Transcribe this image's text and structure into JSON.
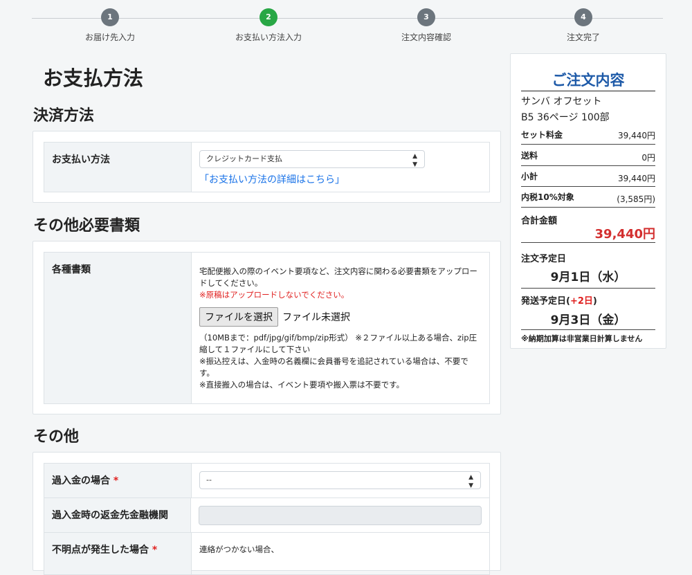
{
  "steps": [
    {
      "num": "1",
      "label": "お届け先入力"
    },
    {
      "num": "2",
      "label": "お支払い方法入力"
    },
    {
      "num": "3",
      "label": "注文内容確認"
    },
    {
      "num": "4",
      "label": "注文完了"
    }
  ],
  "page_title": "お支払方法",
  "payment": {
    "section_title": "決済方法",
    "row_label": "お支払い方法",
    "select_value": "クレジットカード支払",
    "detail_link": "「お支払い方法の詳細はこちら」"
  },
  "documents": {
    "section_title": "その他必要書類",
    "row_label": "各種書類",
    "desc": "宅配便搬入の際のイベント要項など、注文内容に関わる必要書類をアップロードしてください。",
    "warning": "※原稿はアップロードしないでください。",
    "file_button": "ファイルを選択",
    "file_status": "ファイル未選択",
    "note1": "（10MBまで：pdf/jpg/gif/bmp/zip形式） ※２ファイル以上ある場合、zip圧縮して１ファイルにして下さい",
    "note2": "※振込控えは、入金時の名義欄に会員番号を追記されている場合は、不要です。",
    "note3": "※直接搬入の場合は、イベント要項や搬入票は不要です。"
  },
  "other": {
    "section_title": "その他",
    "row1_label": "過入金の場合",
    "row1_select": "--",
    "row2_label": "過入金時の返金先金融機関",
    "row3_label": "不明点が発生した場合",
    "row3_text": "連絡がつかない場合、",
    "required_mark": "*"
  },
  "summary": {
    "title": "ご注文内容",
    "product_name": "サンバ オフセット",
    "product_spec": "B5  36ページ  100部",
    "set_price_label": "セット料金",
    "set_price": "39,440円",
    "shipping_label": "送料",
    "shipping": "0円",
    "subtotal_label": "小計",
    "subtotal": "39,440円",
    "tax_label": "内税10%対象",
    "tax": "(3,585円)",
    "total_label": "合計金額",
    "total": "39,440円",
    "order_date_label": "注文予定日",
    "order_date": "9月1日（水）",
    "ship_date_label_a": "発送予定日(",
    "ship_date_plus": "+2日",
    "ship_date_label_b": ")",
    "ship_date": "9月3日（金）",
    "note": "※納期加算は非営業日計算しません"
  },
  "colors": {
    "active_step": "#28a745",
    "inactive_step": "#6c757d",
    "link": "#1a73e8",
    "accent_red": "#d32f2f",
    "summary_title": "#1e5aa8"
  }
}
